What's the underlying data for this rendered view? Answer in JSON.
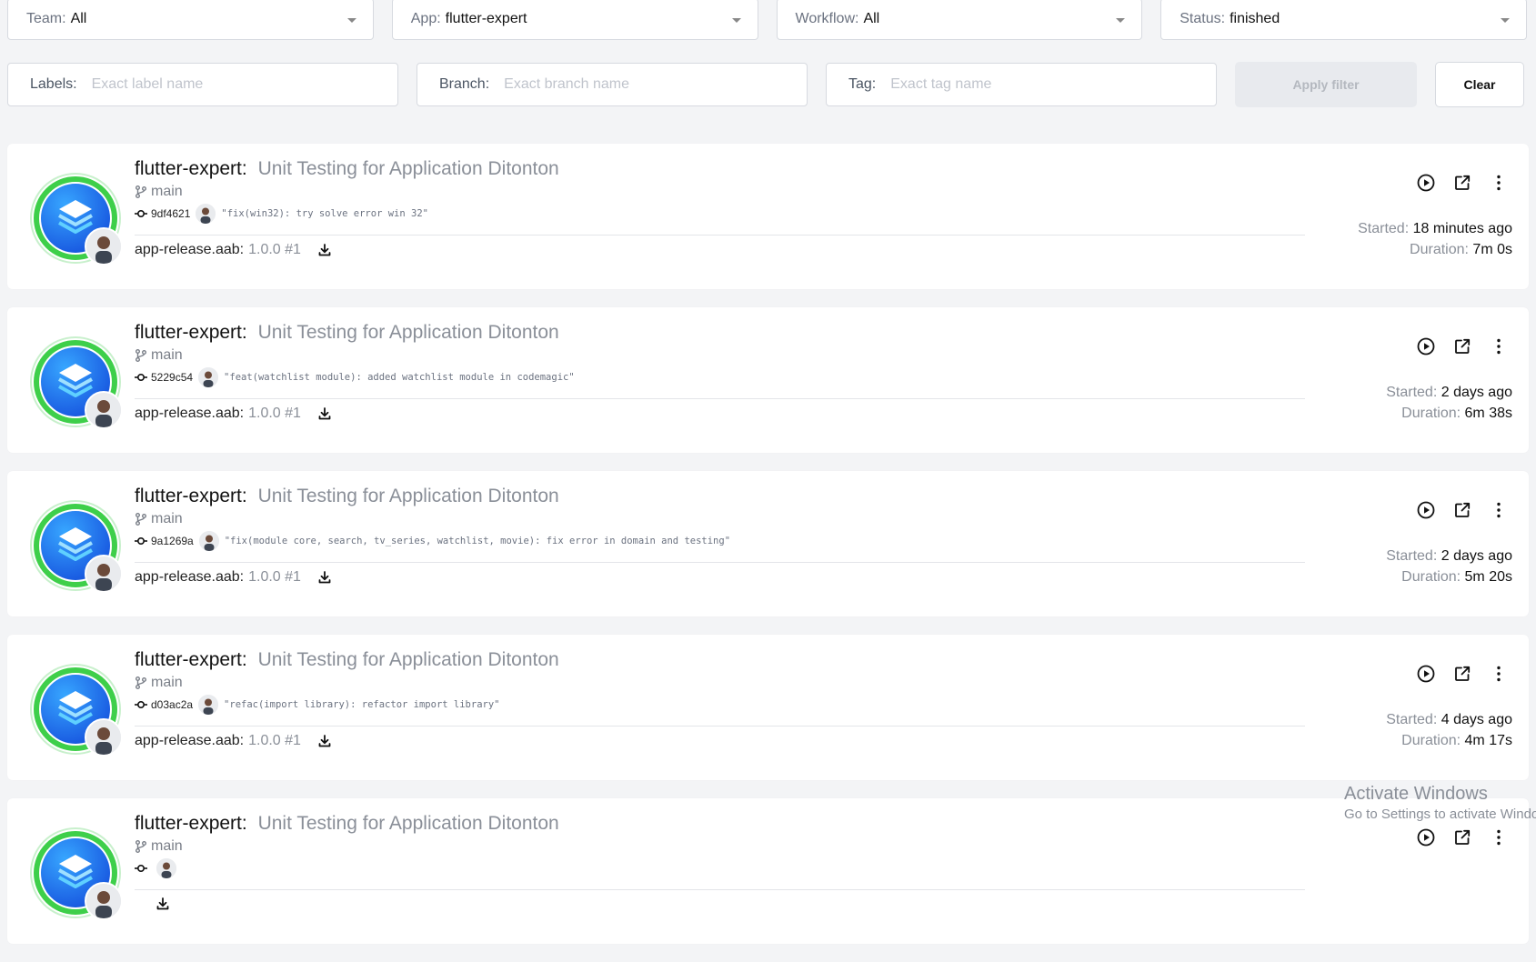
{
  "filters": {
    "team": {
      "label": "Team:",
      "value": "All"
    },
    "app": {
      "label": "App:",
      "value": "flutter-expert"
    },
    "workflow": {
      "label": "Workflow:",
      "value": "All"
    },
    "status": {
      "label": "Status:",
      "value": "finished"
    },
    "labels": {
      "label": "Labels:",
      "placeholder": "Exact label name"
    },
    "branch": {
      "label": "Branch:",
      "placeholder": "Exact branch name"
    },
    "tag": {
      "label": "Tag:",
      "placeholder": "Exact tag name"
    },
    "apply_label": "Apply filter",
    "clear_label": "Clear"
  },
  "builds": [
    {
      "app": "flutter-expert:",
      "workflow": "Unit Testing for Application Ditonton",
      "branch": "main",
      "commit": "9df4621",
      "message": "\"fix(win32): try solve error win 32\"",
      "artifact": "app-release.aab:",
      "version": "1.0.0 #1",
      "started_label": "Started:",
      "started": "18 minutes ago",
      "duration_label": "Duration:",
      "duration": "7m 0s"
    },
    {
      "app": "flutter-expert:",
      "workflow": "Unit Testing for Application Ditonton",
      "branch": "main",
      "commit": "5229c54",
      "message": "\"feat(watchlist module): added watchlist module in codemagic\"",
      "artifact": "app-release.aab:",
      "version": "1.0.0 #1",
      "started_label": "Started:",
      "started": "2 days ago",
      "duration_label": "Duration:",
      "duration": "6m 38s"
    },
    {
      "app": "flutter-expert:",
      "workflow": "Unit Testing for Application Ditonton",
      "branch": "main",
      "commit": "9a1269a",
      "message": "\"fix(module core, search, tv_series, watchlist, movie): fix error in domain and testing\"",
      "artifact": "app-release.aab:",
      "version": "1.0.0 #1",
      "started_label": "Started:",
      "started": "2 days ago",
      "duration_label": "Duration:",
      "duration": "5m 20s"
    },
    {
      "app": "flutter-expert:",
      "workflow": "Unit Testing for Application Ditonton",
      "branch": "main",
      "commit": "d03ac2a",
      "message": "\"refac(import library): refactor import library\"",
      "artifact": "app-release.aab:",
      "version": "1.0.0 #1",
      "started_label": "Started:",
      "started": "4 days ago",
      "duration_label": "Duration:",
      "duration": "4m 17s"
    },
    {
      "app": "flutter-expert:",
      "workflow": "Unit Testing for Application Ditonton",
      "branch": "main"
    }
  ],
  "watermark": {
    "line1": "Activate Windows",
    "line2": "Go to Settings to activate Windo"
  },
  "colors": {
    "ring": "#3ecf4a",
    "logo": "#1b5fe3"
  }
}
